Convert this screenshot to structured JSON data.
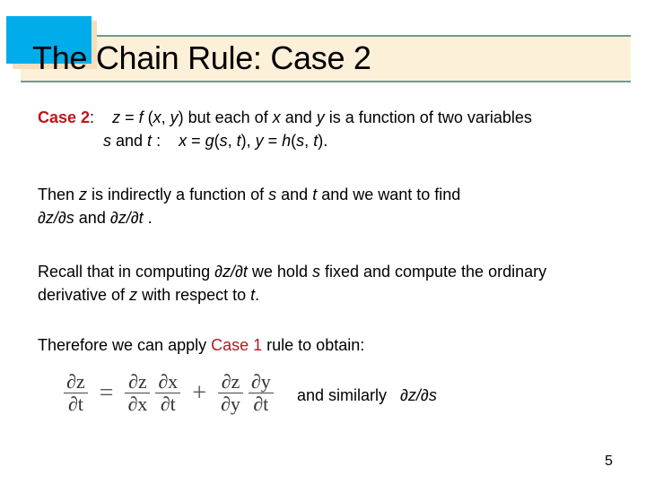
{
  "slide": {
    "title": "The Chain Rule: Case 2",
    "page_number": "5",
    "colors": {
      "accent_square": "#00adea",
      "title_bar": "#fdf0d8",
      "title_bar_border": "#6f9a8e",
      "highlight_red": "#c0141c"
    }
  },
  "para1": {
    "label": "Case 2",
    "colon": ":",
    "text_a": "z",
    "text_b": " = ",
    "text_c": "f",
    "text_d": " (",
    "text_e": "x",
    "text_f": ", ",
    "text_g": "y",
    "text_h": ") but each of ",
    "text_i": "x",
    "text_j": " and ",
    "text_k": "y",
    "text_l": " is a function of two variables",
    "line2_a": "s",
    "line2_b": " and ",
    "line2_c": "t",
    "line2_d": " :    ",
    "line2_e": "x",
    "line2_f": " = ",
    "line2_g": "g",
    "line2_h": "(",
    "line2_i": "s",
    "line2_j": ", ",
    "line2_k": "t",
    "line2_l": "), ",
    "line2_m": "y",
    "line2_n": " = ",
    "line2_o": "h",
    "line2_p": "(",
    "line2_q": "s",
    "line2_r": ", ",
    "line2_s": "t",
    "line2_t": ")."
  },
  "para2": {
    "a": "Then ",
    "b": "z",
    "c": " is indirectly a function of ",
    "d": "s",
    "e": " and ",
    "f": "t",
    "g": " and we want to find",
    "h": "∂z/∂s",
    "i": " and ",
    "j": "∂z/∂t",
    "k": " ."
  },
  "para3": {
    "a": "Recall that in computing ",
    "b": "∂z/∂t",
    "c": " we hold ",
    "d": "s",
    "e": " fixed and compute the ordinary",
    "f": "derivative of ",
    "g": "z",
    "h": " with respect to ",
    "i": "t",
    "j": "."
  },
  "para4": {
    "a": "Therefore we can apply ",
    "b": "Case 1",
    "c": " rule to obtain:"
  },
  "formula": {
    "lhs_num": "∂z",
    "lhs_den": "∂t",
    "equals": "=",
    "t1_num": "∂z",
    "t1_den": "∂x",
    "t2_num": "∂x",
    "t2_den": "∂t",
    "plus": "+",
    "t3_num": "∂z",
    "t3_den": "∂y",
    "t4_num": "∂y",
    "t4_den": "∂t"
  },
  "similarly": {
    "text": "and similarly   ",
    "expr": "∂z/∂s"
  }
}
